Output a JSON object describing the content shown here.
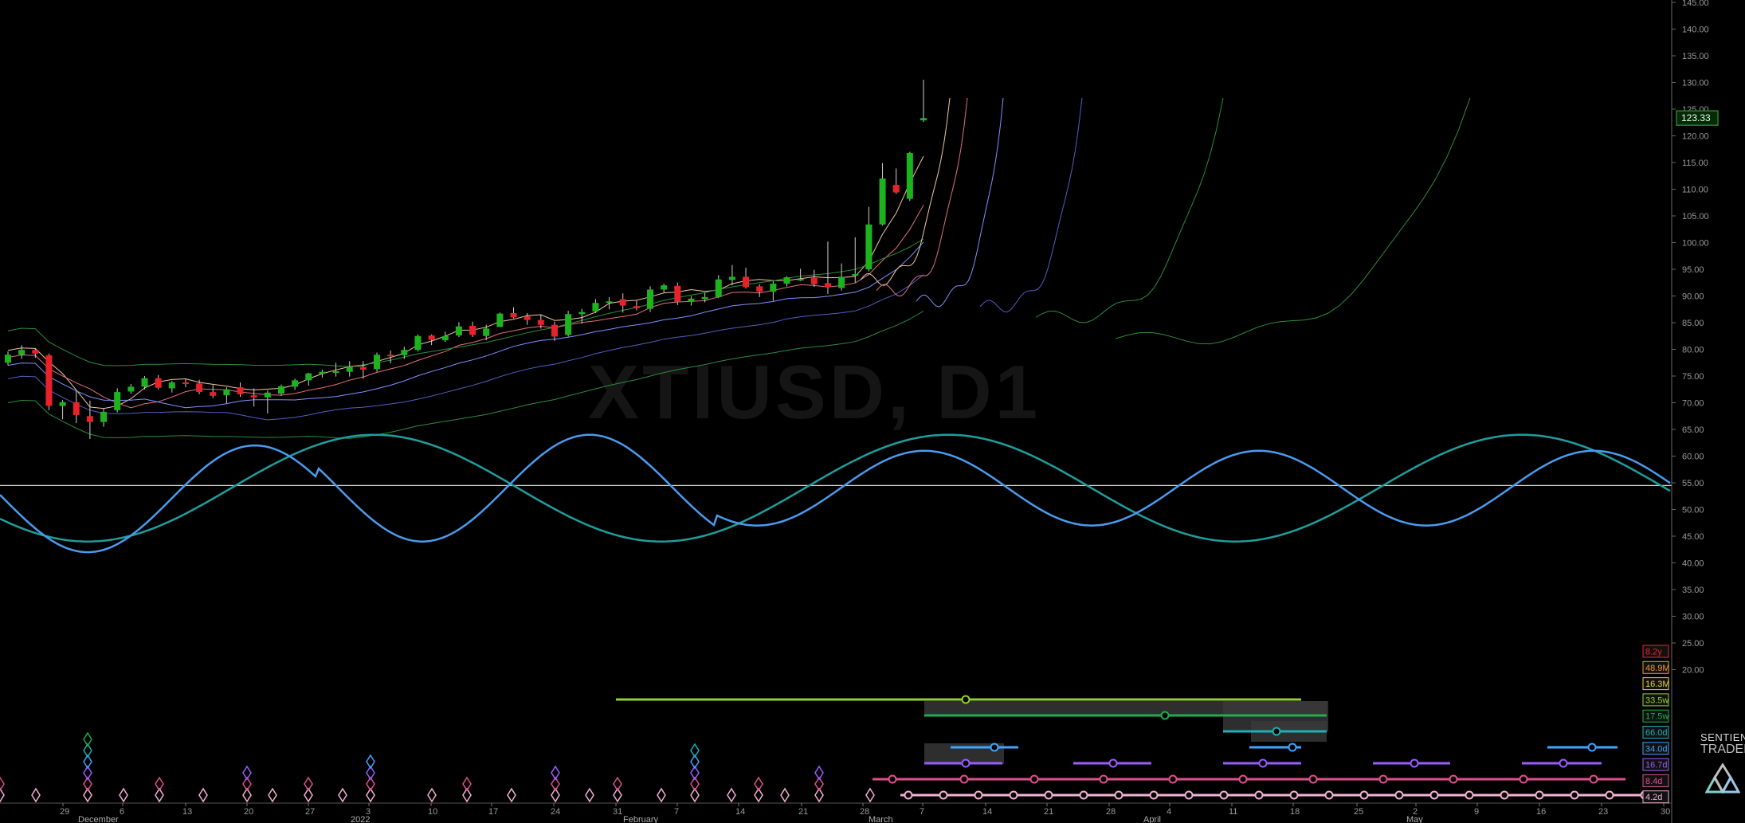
{
  "watermark": "XTIUSD, D1",
  "brand": {
    "line1": "SENTIENT",
    "line2": "TRADER"
  },
  "colors": {
    "background": "#000000",
    "bull": "#1db31d",
    "bear": "#e8222a",
    "cycle_fast": "#4a9cf0",
    "cycle_slow": "#1f9e9e",
    "price_badge": "#2e7d32"
  },
  "chart_data": {
    "type": "candlestick",
    "title": "XTIUSD, D1",
    "ylim": [
      15,
      145
    ],
    "y_ticks": [
      "145.00",
      "140.00",
      "135.00",
      "130.00",
      "125.00",
      "120.00",
      "115.00",
      "110.00",
      "105.00",
      "100.00",
      "95.00",
      "90.00",
      "85.00",
      "80.00",
      "75.00",
      "70.00",
      "65.00",
      "60.00",
      "55.00",
      "50.00",
      "45.00",
      "40.00",
      "35.00",
      "30.00",
      "25.00",
      "20.00"
    ],
    "last_price": "123.33",
    "x_ticks": [
      "29",
      "6",
      "13",
      "20",
      "27",
      "3",
      "10",
      "17",
      "24",
      "31",
      "7",
      "14",
      "21",
      "28",
      "7",
      "14",
      "21",
      "28",
      "4",
      "11",
      "18",
      "25",
      "2",
      "9",
      "16",
      "23",
      "30"
    ],
    "month_labels": [
      "December",
      "2022",
      "February",
      "March",
      "April",
      "May"
    ],
    "candles": [
      [
        77.5,
        79.6,
        77.0,
        79.0
      ],
      [
        79.0,
        80.8,
        78.2,
        79.9
      ],
      [
        79.9,
        80.2,
        78.4,
        79.2
      ],
      [
        78.9,
        79.2,
        68.6,
        69.4
      ],
      [
        69.4,
        70.5,
        66.9,
        70.1
      ],
      [
        70.1,
        72.2,
        66.2,
        67.7
      ],
      [
        67.5,
        70.4,
        63.2,
        66.4
      ],
      [
        66.4,
        69.0,
        65.5,
        68.3
      ],
      [
        68.6,
        72.7,
        68.2,
        72.0
      ],
      [
        72.1,
        73.5,
        71.7,
        73.0
      ],
      [
        73.0,
        75.0,
        72.5,
        74.6
      ],
      [
        74.6,
        75.2,
        72.5,
        72.8
      ],
      [
        72.7,
        74.1,
        71.9,
        73.8
      ],
      [
        73.8,
        74.4,
        72.9,
        73.5
      ],
      [
        73.6,
        74.3,
        71.6,
        72.0
      ],
      [
        72.0,
        73.3,
        70.9,
        71.3
      ],
      [
        71.4,
        72.9,
        69.9,
        72.5
      ],
      [
        72.9,
        73.8,
        71.1,
        71.6
      ],
      [
        71.4,
        72.7,
        69.3,
        71.0
      ],
      [
        71.0,
        72.3,
        68.0,
        71.9
      ],
      [
        71.7,
        73.4,
        71.3,
        73.1
      ],
      [
        73.0,
        74.5,
        72.4,
        74.2
      ],
      [
        74.2,
        75.6,
        73.2,
        75.5
      ],
      [
        75.4,
        76.2,
        74.7,
        75.8
      ],
      [
        75.7,
        77.5,
        74.9,
        75.9
      ],
      [
        75.8,
        77.8,
        74.9,
        76.7
      ],
      [
        76.7,
        77.8,
        74.5,
        76.2
      ],
      [
        76.3,
        79.4,
        75.8,
        79.0
      ],
      [
        79.0,
        79.8,
        77.4,
        78.8
      ],
      [
        78.9,
        80.5,
        78.2,
        79.9
      ],
      [
        79.9,
        82.8,
        79.6,
        82.5
      ],
      [
        82.6,
        82.8,
        80.8,
        81.8
      ],
      [
        81.7,
        83.3,
        81.4,
        82.5
      ],
      [
        82.6,
        85.1,
        82.3,
        84.3
      ],
      [
        84.4,
        85.2,
        82.3,
        82.7
      ],
      [
        82.5,
        84.6,
        81.7,
        83.9
      ],
      [
        84.2,
        86.9,
        84.2,
        86.7
      ],
      [
        86.8,
        87.9,
        85.8,
        86.0
      ],
      [
        86.2,
        86.8,
        84.6,
        85.5
      ],
      [
        85.5,
        86.5,
        83.9,
        84.6
      ],
      [
        84.6,
        85.2,
        81.6,
        82.4
      ],
      [
        82.7,
        87.2,
        82.4,
        86.6
      ],
      [
        86.6,
        87.6,
        84.8,
        87.0
      ],
      [
        87.1,
        89.4,
        86.8,
        88.7
      ],
      [
        88.7,
        89.8,
        87.5,
        89.0
      ],
      [
        89.4,
        90.5,
        86.9,
        88.2
      ],
      [
        88.1,
        89.1,
        87.3,
        87.7
      ],
      [
        87.6,
        91.8,
        87.0,
        91.2
      ],
      [
        91.2,
        92.3,
        90.7,
        92.0
      ],
      [
        91.9,
        92.5,
        88.3,
        88.9
      ],
      [
        88.9,
        90.0,
        88.2,
        89.5
      ],
      [
        89.4,
        90.6,
        88.8,
        89.8
      ],
      [
        89.8,
        93.9,
        89.6,
        93.1
      ],
      [
        93.0,
        95.8,
        92.0,
        93.6
      ],
      [
        93.6,
        95.3,
        91.4,
        91.7
      ],
      [
        91.8,
        92.2,
        89.8,
        90.8
      ],
      [
        90.8,
        92.8,
        89.1,
        92.3
      ],
      [
        92.3,
        93.7,
        91.8,
        93.5
      ],
      [
        92.9,
        95.1,
        92.8,
        93.2
      ],
      [
        93.4,
        94.9,
        91.7,
        92.2
      ],
      [
        92.4,
        100.2,
        90.4,
        91.6
      ],
      [
        91.5,
        96.1,
        91.0,
        93.6
      ],
      [
        93.9,
        101.0,
        92.5,
        94.1
      ],
      [
        95.0,
        106.7,
        94.6,
        103.4
      ],
      [
        103.4,
        114.9,
        103.2,
        112.0
      ],
      [
        110.8,
        113.9,
        109.1,
        109.4
      ],
      [
        108.2,
        117.0,
        107.8,
        116.8
      ],
      [
        122.9,
        130.5,
        122.6,
        123.33
      ]
    ],
    "cycles": [
      {
        "name": "fast",
        "color": "#4a9cf0"
      },
      {
        "name": "slow",
        "color": "#1f9e9e"
      }
    ],
    "horizontal_line": 54.5,
    "badges": [
      {
        "label": "8.2y",
        "color": "#e8222a"
      },
      {
        "label": "48.9M",
        "color": "#f29a1d"
      },
      {
        "label": "16.3M",
        "color": "#e6d22f"
      },
      {
        "label": "33.5w",
        "color": "#8fd12f"
      },
      {
        "label": "17.5w",
        "color": "#1fae4e"
      },
      {
        "label": "66.0d",
        "color": "#1ab0b8"
      },
      {
        "label": "34.0d",
        "color": "#3fa3ff"
      },
      {
        "label": "16.7d",
        "color": "#9a5cff"
      },
      {
        "label": "8.4d",
        "color": "#e0508f"
      },
      {
        "label": "4.2d",
        "color": "#f4b2d6"
      }
    ]
  }
}
